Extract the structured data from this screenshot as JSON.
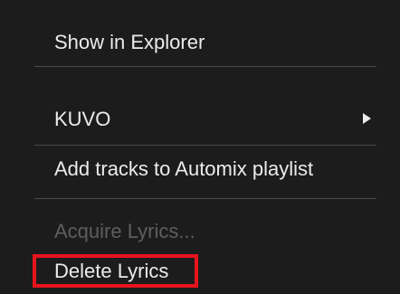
{
  "context_menu": {
    "items": [
      {
        "label": "Show in Explorer",
        "enabled": true
      },
      {
        "label": "KUVO",
        "enabled": true,
        "has_submenu": true,
        "submenu_icon": "triangle-right-icon"
      },
      {
        "label": "Add tracks to Automix playlist",
        "enabled": true
      },
      {
        "label": "Acquire Lyrics...",
        "enabled": false
      },
      {
        "label": "Delete Lyrics",
        "enabled": true,
        "highlighted": true
      }
    ],
    "highlight_color": "#e8141c",
    "background_color": "#1c1c1c",
    "text_color": "#ececec",
    "disabled_text_color": "#5e5e5e"
  }
}
